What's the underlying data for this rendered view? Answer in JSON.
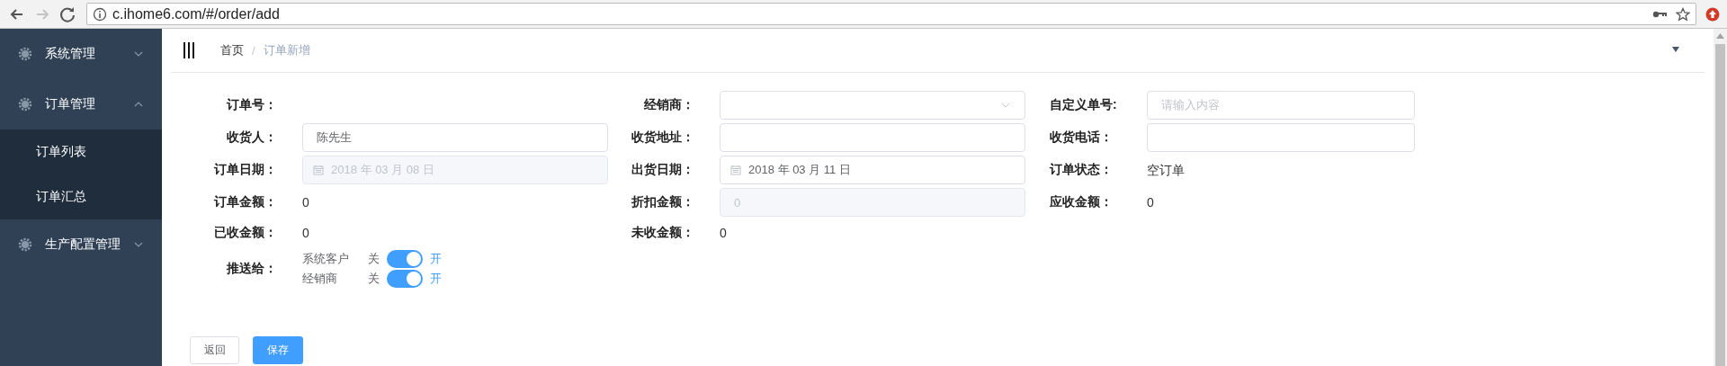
{
  "browser": {
    "url": "c.ihome6.com/#/order/add"
  },
  "sidebar": {
    "items": [
      {
        "label": "系统管理",
        "expanded": false
      },
      {
        "label": "订单管理",
        "expanded": true,
        "children": [
          {
            "label": "订单列表"
          },
          {
            "label": "订单汇总"
          }
        ]
      },
      {
        "label": "生产配置管理",
        "expanded": false
      }
    ]
  },
  "breadcrumb": {
    "items": [
      "首页",
      "订单新增"
    ],
    "separator": "/"
  },
  "form": {
    "rows": [
      [
        {
          "kind": "text",
          "label": "订单号："
        },
        {
          "kind": "select",
          "label": "经销商："
        },
        {
          "kind": "input",
          "label": "自定义单号:",
          "placeholder": "请输入内容"
        }
      ],
      [
        {
          "kind": "input",
          "label": "收货人：",
          "value": "陈先生"
        },
        {
          "kind": "input",
          "label": "收货地址："
        },
        {
          "kind": "input",
          "label": "收货电话："
        }
      ],
      [
        {
          "kind": "date",
          "label": "订单日期：",
          "value": "2018 年 03 月 08 日",
          "disabled": true
        },
        {
          "kind": "date",
          "label": "出货日期：",
          "value": "2018 年 03 月 11 日",
          "disabled": false
        },
        {
          "kind": "text",
          "label": "订单状态：",
          "value": "空订单"
        }
      ],
      [
        {
          "kind": "text",
          "label": "订单金额：",
          "value": "0"
        },
        {
          "kind": "input",
          "label": "折扣金额：",
          "value": "0",
          "disabled": true
        },
        {
          "kind": "text",
          "label": "应收金额：",
          "value": "0"
        }
      ],
      [
        {
          "kind": "text",
          "label": "已收金额：",
          "value": "0"
        },
        {
          "kind": "text",
          "label": "未收金额：",
          "value": "0"
        }
      ],
      [
        {
          "kind": "switches",
          "label": "推送给：",
          "switches": [
            {
              "label": "系统客户",
              "off_label": "关",
              "on_label": "开",
              "on": true
            },
            {
              "label": "经销商",
              "off_label": "关",
              "on_label": "开",
              "on": true
            }
          ]
        }
      ]
    ]
  },
  "buttons": [
    {
      "label": "返回",
      "kind": "default"
    },
    {
      "label": "保存",
      "kind": "primary"
    }
  ]
}
